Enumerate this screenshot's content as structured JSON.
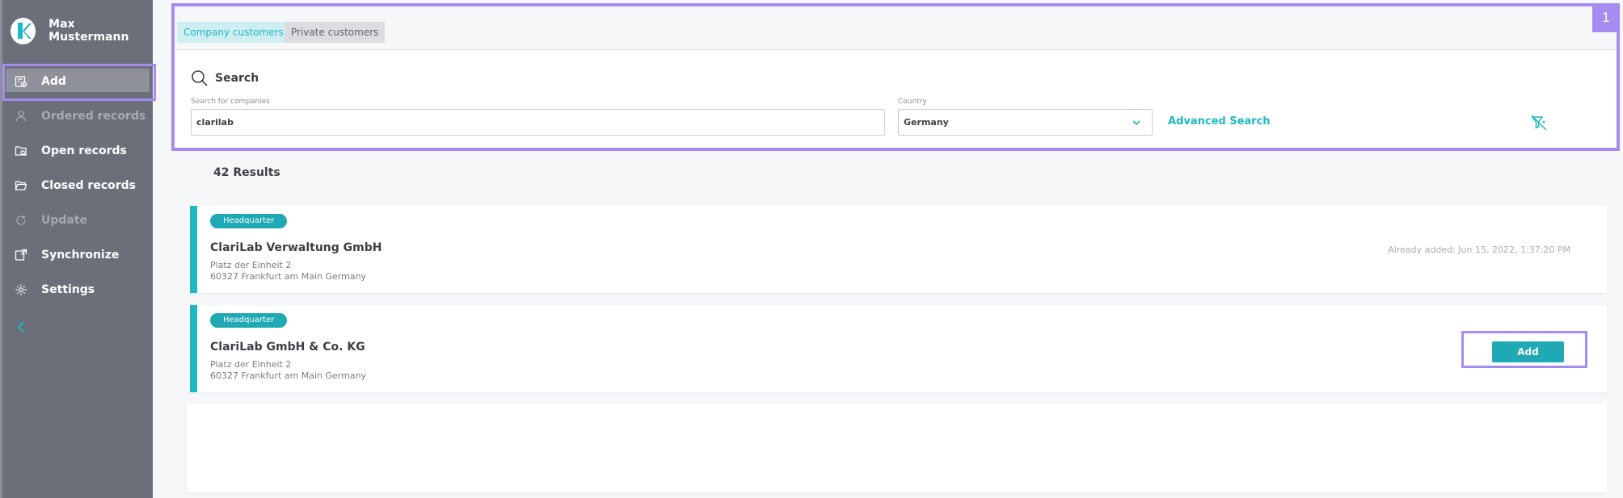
{
  "user": {
    "name": "Max Mustermann"
  },
  "sidebar": {
    "items": [
      {
        "label": "Add",
        "icon": "add-record-icon",
        "active": true,
        "dim": false
      },
      {
        "label": "Ordered records",
        "icon": "person-icon",
        "active": false,
        "dim": true
      },
      {
        "label": "Open records",
        "icon": "folder-search-icon",
        "active": false,
        "dim": false
      },
      {
        "label": "Closed records",
        "icon": "folder-open-icon",
        "active": false,
        "dim": false
      },
      {
        "label": "Update",
        "icon": "refresh-icon",
        "active": false,
        "dim": true
      },
      {
        "label": "Synchronize",
        "icon": "sync-icon",
        "active": false,
        "dim": false
      },
      {
        "label": "Settings",
        "icon": "gear-icon",
        "active": false,
        "dim": false
      }
    ],
    "collapse_icon": "chevron-left-icon"
  },
  "tabs": [
    {
      "label": "Company customers",
      "active": true
    },
    {
      "label": "Private customers",
      "active": false
    }
  ],
  "annotation_number": "1",
  "search": {
    "title": "Search",
    "company_label": "Search for companies",
    "company_value": "clarilab",
    "country_label": "Country",
    "country_value": "Germany",
    "advanced_label": "Advanced Search",
    "clear_icon": "clear-filter-icon"
  },
  "results": {
    "count_label": "42 Results",
    "items": [
      {
        "tag": "Headquarter",
        "name": "ClariLab Verwaltung GmbH",
        "street": "Platz der Einheit 2",
        "city": "60327 Frankfurt am Main Germany",
        "already_added": "Already added:  Jun 15, 2022, 1:37:20 PM"
      },
      {
        "tag": "Headquarter",
        "name": "ClariLab GmbH & Co. KG",
        "street": "Platz der Einheit 2",
        "city": "60327 Frankfurt am Main Germany",
        "action_label": "Add"
      }
    ]
  },
  "colors": {
    "accent": "#1eb8c4",
    "sidebar": "#6b6f7a",
    "highlight": "#a68cf0"
  }
}
